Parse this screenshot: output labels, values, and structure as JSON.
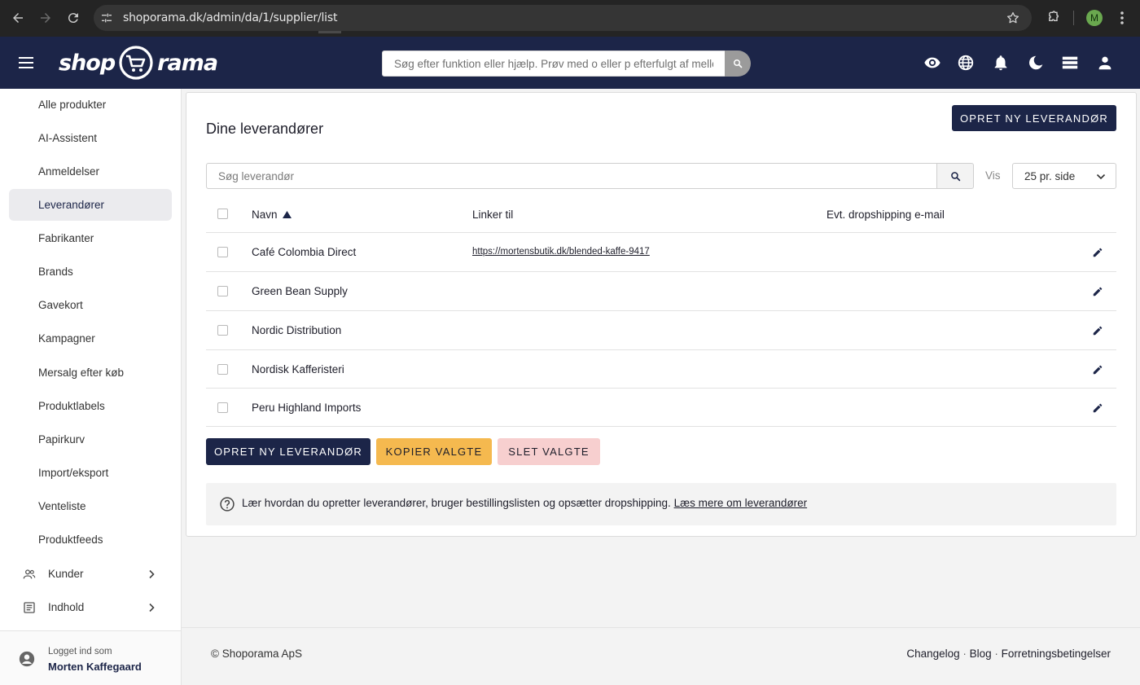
{
  "browser": {
    "url": "shoporama.dk/admin/da/1/supplier/list",
    "profile_initial": "M"
  },
  "header": {
    "logo_left": "shop",
    "logo_right": "rama",
    "search_placeholder": "Søg efter funktion eller hjælp. Prøv med o eller p efterfulgt af mellemrum",
    "icons": [
      "eye-icon",
      "globe-icon",
      "bell-icon",
      "moon-icon",
      "storage-icon",
      "account-icon"
    ]
  },
  "sidebar": {
    "items": [
      {
        "label": "Alle produkter",
        "active": false
      },
      {
        "label": "AI-Assistent",
        "active": false
      },
      {
        "label": "Anmeldelser",
        "active": false
      },
      {
        "label": "Leverandører",
        "active": true
      },
      {
        "label": "Fabrikanter",
        "active": false
      },
      {
        "label": "Brands",
        "active": false
      },
      {
        "label": "Gavekort",
        "active": false
      },
      {
        "label": "Kampagner",
        "active": false
      },
      {
        "label": "Mersalg efter køb",
        "active": false
      },
      {
        "label": "Produktlabels",
        "active": false
      },
      {
        "label": "Papirkurv",
        "active": false
      },
      {
        "label": "Import/eksport",
        "active": false
      },
      {
        "label": "Venteliste",
        "active": false
      },
      {
        "label": "Produktfeeds",
        "active": false
      }
    ],
    "groups": [
      {
        "label": "Kunder",
        "icon": "people-icon"
      },
      {
        "label": "Indhold",
        "icon": "article-icon"
      }
    ],
    "logged_in_label": "Logget ind som",
    "user_name": "Morten Kaffegaard"
  },
  "main": {
    "title": "Dine leverandører",
    "create_label": "Opret ny leverandør",
    "search_placeholder": "Søg leverandør",
    "vis_label": "Vis",
    "per_page": "25 pr. side",
    "columns": {
      "name": "Navn",
      "links": "Linker til",
      "email": "Evt. dropshipping e-mail"
    },
    "rows": [
      {
        "name": "Café Colombia Direct",
        "link": "https://mortensbutik.dk/blended-kaffe-9417",
        "email": ""
      },
      {
        "name": "Green Bean Supply",
        "link": "",
        "email": ""
      },
      {
        "name": "Nordic Distribution",
        "link": "",
        "email": ""
      },
      {
        "name": "Nordisk Kafferisteri",
        "link": "",
        "email": ""
      },
      {
        "name": "Peru Highland Imports",
        "link": "",
        "email": ""
      }
    ],
    "copy_label": "KOPIER VALGTE",
    "delete_label": "SLET VALGTE",
    "help_text": "Lær hvordan du opretter leverandører, bruger bestillingslisten og opsætter dropshipping.",
    "help_link": "Læs mere om leverandører"
  },
  "footer": {
    "copyright": "© Shoporama ApS",
    "links": [
      "Changelog",
      "Blog",
      "Forretningsbetingelser"
    ]
  },
  "colors": {
    "navy": "#1c2548",
    "copy_button": "#f5b94f",
    "delete_button": "#f7cfcf"
  }
}
